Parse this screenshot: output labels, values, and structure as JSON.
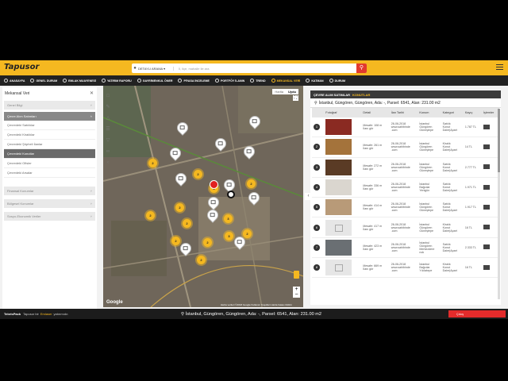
{
  "app": {
    "brand": "Tapusor"
  },
  "search": {
    "dropdown_label": "DETAYLI ARAMA ▾",
    "placeholder": "İl, ilçe, mahalle ile ara"
  },
  "menu": [
    {
      "label": "ANASAYFA",
      "active": false
    },
    {
      "label": "GENEL DURUM",
      "active": false
    },
    {
      "label": "EMLAK MUAYENESİ",
      "active": false
    },
    {
      "label": "YATIRIM RAPORU",
      "active": false
    },
    {
      "label": "GAYRİMENKUL ÖNER",
      "active": false
    },
    {
      "label": "PİYASA İNCELEME",
      "active": false
    },
    {
      "label": "PORTFÖY İLANIN",
      "active": false
    },
    {
      "label": "TREND",
      "active": false
    },
    {
      "label": "MEKANSAL VERİ",
      "active": true
    },
    {
      "label": "KATMAN",
      "active": false
    },
    {
      "label": "DURUM",
      "active": false
    }
  ],
  "left": {
    "title": "Mekansal Veri",
    "sections_top": [
      "Genel Bilgi"
    ],
    "open_section": "Çevre Alım Satımları",
    "sub_items": [
      {
        "label": "Çevredeki Satılıklar",
        "selected": false
      },
      {
        "label": "Çevredeki Kiralıklar",
        "selected": false
      },
      {
        "label": "Çevredeki Şüpheli İlanlar",
        "selected": false
      },
      {
        "label": "Çevredeki Konutlar",
        "selected": true
      },
      {
        "label": "Çevredeki Ofisler",
        "selected": false
      },
      {
        "label": "Çevredeki Arsalar",
        "selected": false
      }
    ],
    "sections_bottom": [
      "Finansal Konumlar",
      "Bölgesel Konumlar",
      "Sosyo-Ekonomik Veriler"
    ]
  },
  "map": {
    "tabs": [
      {
        "label": "Harita",
        "on": false
      },
      {
        "label": "Uydu",
        "on": true
      }
    ],
    "google": "Google",
    "footer": "Harita verileri ©2018 Google  Kullanım Koşulları  Harita hatası bildirin"
  },
  "right": {
    "header": "ÇEVRE ALIM SATIMLAR",
    "header_extra": "KONUTLAR",
    "address": "İstanbul, Güngören, Güngören, Ada: -, Parsel: 6541, Alan: 231.00 m2",
    "columns": [
      "",
      "Fotoğraf",
      "Detail",
      "İlan Tarihi",
      "Konum",
      "Kategori",
      "Kayıç",
      "İşlemler"
    ],
    "rows": [
      {
        "n": "1",
        "photo": "red",
        "detail": "Mesafe: 108 m\nİlanı gör",
        "date": "26-06-2018\nwww.sahibinde\n.com",
        "loc": "İstanbul\nGüngören\nGüneştepe",
        "cat": "Satılık\nKonut\nDaire|Apart",
        "price": "1.787 TL"
      },
      {
        "n": "2",
        "photo": "wood",
        "detail": "Mesafe: 261 m\nİlanı gör",
        "date": "26-06-2018\nwww.sahibinde\n.com",
        "loc": "İstanbul\nGüngören\nGüneştepe",
        "cat": "Kiralık\nKonut\nDaire|Apart",
        "price": "14 TL"
      },
      {
        "n": "3",
        "photo": "brown",
        "detail": "Mesafe: 272 m\nİlanı gör",
        "date": "26-06-2018\nwww.sahibinde\n.com",
        "loc": "İstanbul\nGüngören\nGüneştepe",
        "cat": "Satılık\nKonut\nDaire|Apart",
        "price": "2.777 TL"
      },
      {
        "n": "4",
        "photo": "white",
        "detail": "Mesafe: 336 m\nİlanı gör",
        "date": "26-06-2018\nwww.sahibinde\n.com",
        "loc": "İstanbul\nBağcılar\nYenigün",
        "cat": "Satılık\nKonut\nDaire|Apart",
        "price": "1.971 TL"
      },
      {
        "n": "5",
        "photo": "tan",
        "detail": "Mesafe: 414 m\nİlanı gör",
        "date": "26-06-2018\nwww.sahibinde\n.com",
        "loc": "İstanbul\nGüngören\nGüneştepe",
        "cat": "Satılık\nKonut\nDaire|Apart",
        "price": "1.917 TL"
      },
      {
        "n": "6",
        "photo": "ph",
        "detail": "Mesafe: 417 m\nİlanı gör",
        "date": "26-06-2018\nwww.sahibinde\n.com",
        "loc": "İstanbul\nGüngören\nGüneştepe",
        "cat": "Kiralık\nKonut\nDaire|Apart",
        "price": "16 TL"
      },
      {
        "n": "7",
        "photo": "room",
        "detail": "Mesafe: 423 m\nİlanı gör",
        "date": "26-06-2018\nwww.sahibinde\n.com",
        "loc": "İstanbul\nGüngören\nMerkezdere\nnok",
        "cat": "Satılık\nKonut\nDaire|Apart",
        "price": "2.333 TL"
      },
      {
        "n": "8",
        "photo": "ph",
        "detail": "Mesafe: 669 m\nİlanı gör",
        "date": "26-06-2018\nwww.sahibinde\n.com",
        "loc": "İstanbul\nBağcılar\nYıldıztepe",
        "cat": "Kiralık\nKonut\nDaire|Apart",
        "price": "16 TL"
      }
    ]
  },
  "footer": {
    "logo": "TebrisPack",
    "prefix": "Tapusor bir",
    "brand": "Emlaser",
    "suffix": "yatırımıdır.",
    "center": "İstanbul, Güngören, Güngören, Ada: -, Parsel: 6541, Alan: 231.00 m2",
    "exit": "Çıkış"
  },
  "colors": {
    "accent": "#f5b820",
    "dark": "#222222",
    "danger": "#e32b2b"
  }
}
